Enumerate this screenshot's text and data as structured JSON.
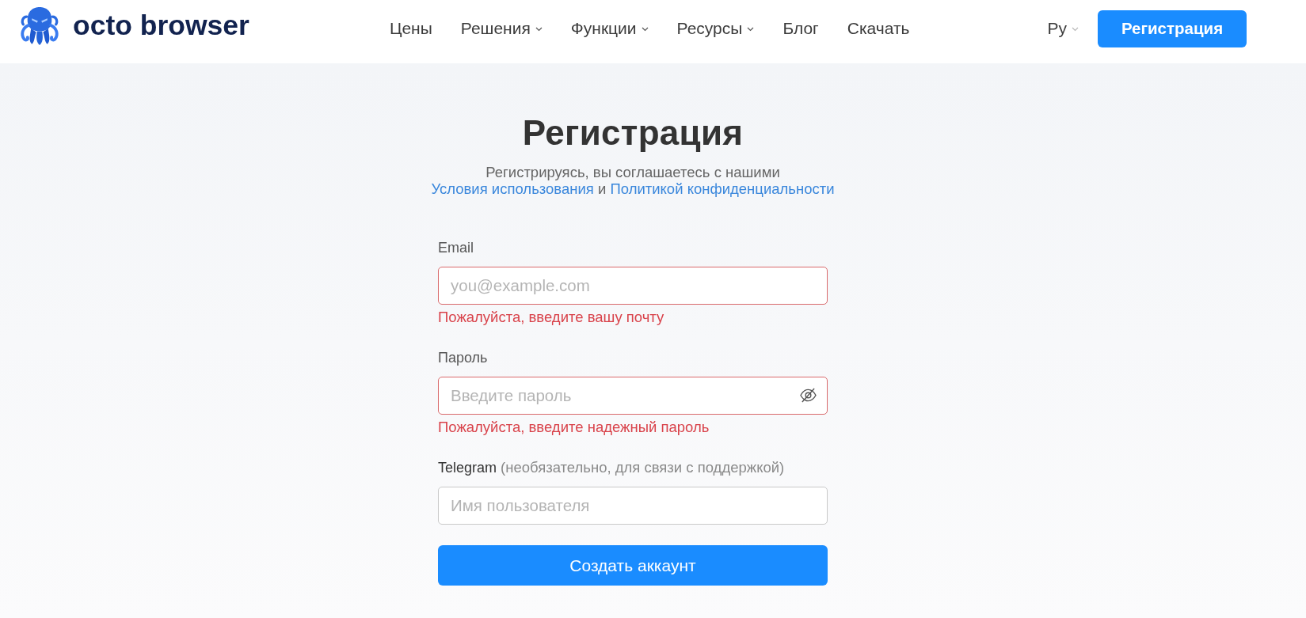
{
  "header": {
    "logo": {
      "text": "octo browser"
    },
    "nav": [
      {
        "label": "Цены",
        "dropdown": false
      },
      {
        "label": "Решения",
        "dropdown": true
      },
      {
        "label": "Функции",
        "dropdown": true
      },
      {
        "label": "Ресурсы",
        "dropdown": true
      },
      {
        "label": "Блог",
        "dropdown": false
      },
      {
        "label": "Скачать",
        "dropdown": false
      }
    ],
    "language": {
      "label": "Ру",
      "dropdown": true
    },
    "register_button": "Регистрация"
  },
  "form": {
    "title": "Регистрация",
    "consent": {
      "text": "Регистрируясь, вы соглашаетесь с нашими",
      "terms_link": "Условия использования",
      "conjunction": "и",
      "privacy_link": "Политикой конфиденциальности"
    },
    "fields": [
      {
        "kind": "text",
        "label": "Email",
        "placeholder": "you@example.com",
        "error": "Пожалуйста, введите вашу почту"
      },
      {
        "kind": "password",
        "label": "Пароль",
        "placeholder": "Введите пароль",
        "error": "Пожалуйста, введите надежный пароль"
      },
      {
        "kind": "text",
        "label": "Telegram",
        "label_note": "(необязательно, для связи с поддержкой)",
        "placeholder": "Имя пользователя"
      }
    ],
    "submit": "Создать аккаунт"
  }
}
